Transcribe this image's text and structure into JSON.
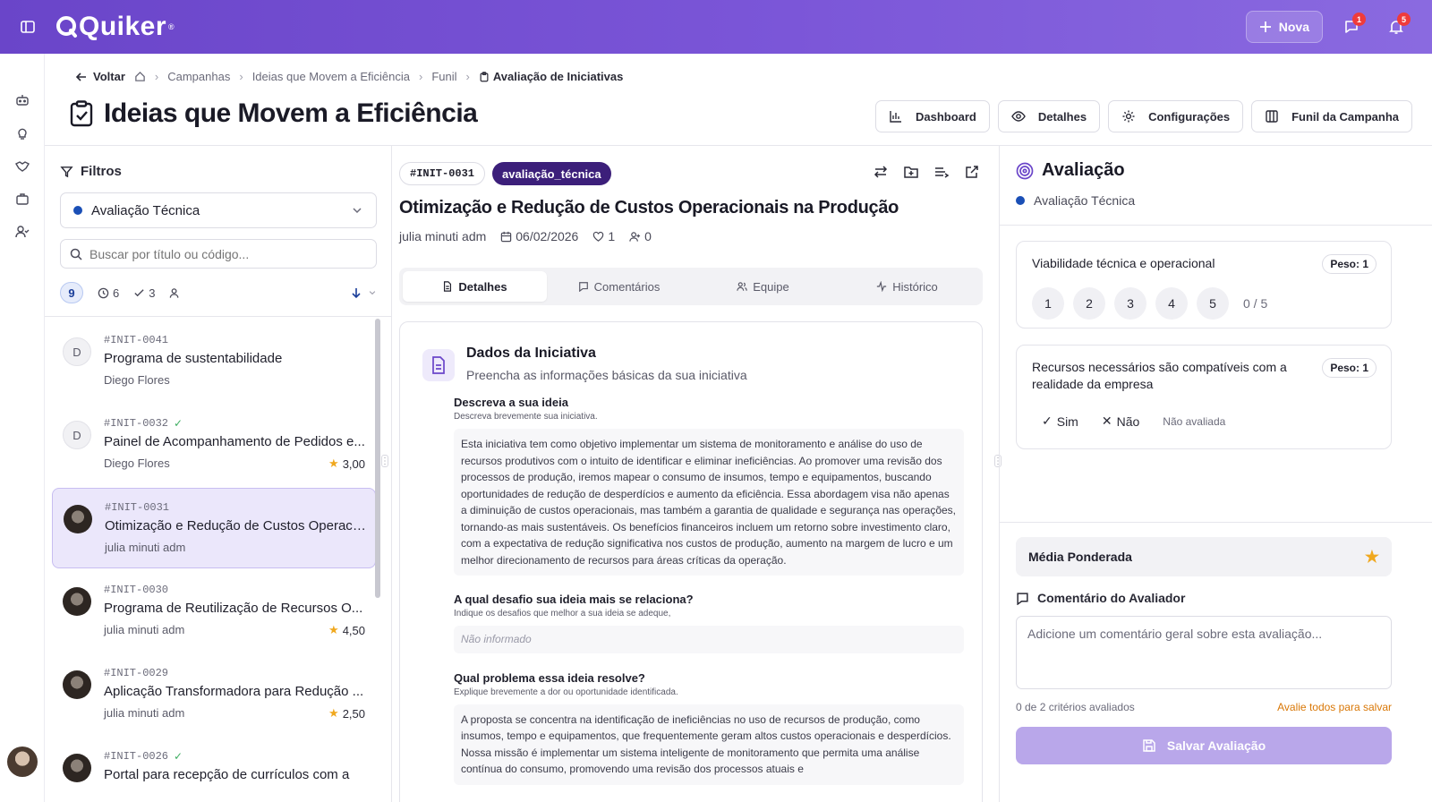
{
  "app": {
    "brand": "Quiker",
    "brand_mark": "®"
  },
  "topbar": {
    "new_label": "Nova",
    "messages_badge": "1",
    "notifications_badge": "5"
  },
  "breadcrumb": {
    "back": "Voltar",
    "items": [
      "Campanhas",
      "Ideias que Movem a Eficiência",
      "Funil"
    ],
    "current": "Avaliação de Iniciativas"
  },
  "page": {
    "title": "Ideias que Movem a Eficiência"
  },
  "header_actions": {
    "dashboard": "Dashboard",
    "details": "Detalhes",
    "settings": "Configurações",
    "funnel": "Funil da Campanha"
  },
  "filters": {
    "title": "Filtros",
    "stage": "Avaliação Técnica",
    "search_placeholder": "Buscar por título ou código...",
    "total": "9",
    "pending": "6",
    "done": "3"
  },
  "list": [
    {
      "avatar": "D",
      "code": "#INIT-0041",
      "checked": false,
      "title": "Programa de sustentabilidade",
      "author": "Diego Flores",
      "score": ""
    },
    {
      "avatar": "D",
      "code": "#INIT-0032",
      "checked": true,
      "title": "Painel de Acompanhamento de Pedidos e...",
      "author": "Diego Flores",
      "score": "3,00"
    },
    {
      "avatar": "",
      "code": "#INIT-0031",
      "checked": false,
      "title": "Otimização e Redução de Custos Operaci...",
      "author": "julia minuti adm",
      "score": ""
    },
    {
      "avatar": "",
      "code": "#INIT-0030",
      "checked": false,
      "title": "Programa de Reutilização de Recursos O...",
      "author": "julia minuti adm",
      "score": "4,50"
    },
    {
      "avatar": "",
      "code": "#INIT-0029",
      "checked": false,
      "title": "Aplicação Transformadora para Redução ...",
      "author": "julia minuti adm",
      "score": "2,50"
    },
    {
      "avatar": "",
      "code": "#INIT-0026",
      "checked": true,
      "title": "Portal para recepção de currículos com a",
      "author": "",
      "score": ""
    }
  ],
  "initiative": {
    "code": "#INIT-0031",
    "status": "avaliação_técnica",
    "title": "Otimização e Redução de Custos Operacionais na Produção",
    "author": "julia minuti adm",
    "date": "06/02/2026",
    "likes": "1",
    "members": "0"
  },
  "tabs": [
    "Detalhes",
    "Comentários",
    "Equipe",
    "Histórico"
  ],
  "card": {
    "title": "Dados da Iniciativa",
    "subtitle": "Preencha as informações básicas da sua iniciativa",
    "fields": [
      {
        "label": "Descreva a sua ideia",
        "hint": "Descreva brevemente sua iniciativa.",
        "value": "Esta iniciativa tem como objetivo implementar um sistema de monitoramento e análise do uso de recursos produtivos com o intuito de identificar e eliminar ineficiências. Ao promover uma revisão dos processos de produção, iremos mapear o consumo de insumos, tempo e equipamentos, buscando oportunidades de redução de desperdícios e aumento da eficiência. Essa abordagem visa não apenas a diminuição de custos operacionais, mas também a garantia de qualidade e segurança nas operações, tornando-as mais sustentáveis. Os benefícios financeiros incluem um retorno sobre investimento claro, com a expectativa de redução significativa nos custos de produção, aumento na margem de lucro e um melhor direcionamento de recursos para áreas críticas da operação."
      },
      {
        "label": "A qual desafio sua ideia mais se relaciona?",
        "hint": "Indique os desafios que melhor a sua ideia se adeque,",
        "value": "Não informado"
      },
      {
        "label": "Qual problema essa ideia resolve?",
        "hint": "Explique brevemente a dor ou oportunidade identificada.",
        "value": "A proposta se concentra na identificação de ineficiências no uso de recursos de produção, como insumos, tempo e equipamentos, que frequentemente geram altos custos operacionais e desperdícios. Nossa missão é implementar um sistema inteligente de monitoramento que permita uma análise contínua do consumo, promovendo uma revisão dos processos atuais e"
      }
    ]
  },
  "evaluation": {
    "title": "Avaliação",
    "stage": "Avaliação Técnica",
    "criteria": [
      {
        "label": "Viabilidade técnica e operacional",
        "weight": "Peso: 1",
        "scale": [
          "1",
          "2",
          "3",
          "4",
          "5"
        ],
        "total": "0 / 5"
      },
      {
        "label": "Recursos necessários são compatíveis com a realidade da empresa",
        "weight": "Peso: 1",
        "yes": "Sim",
        "no": "Não",
        "state": "Não avaliada"
      }
    ],
    "weighted_avg_label": "Média Ponderada",
    "comment_label": "Comentário do Avaliador",
    "comment_placeholder": "Adicione um comentário geral sobre esta avaliação...",
    "progress": "0 de 2 critérios avaliados",
    "warning": "Avalie todos para salvar",
    "save": "Salvar Avaliação"
  },
  "colors": {
    "brand": "#6a45c9",
    "status_tag": "#3c1f7a",
    "stage_dot": "#1a4fb6",
    "star": "#f0a81e",
    "warning": "#d97706",
    "save_button": "#b9a7ea"
  }
}
